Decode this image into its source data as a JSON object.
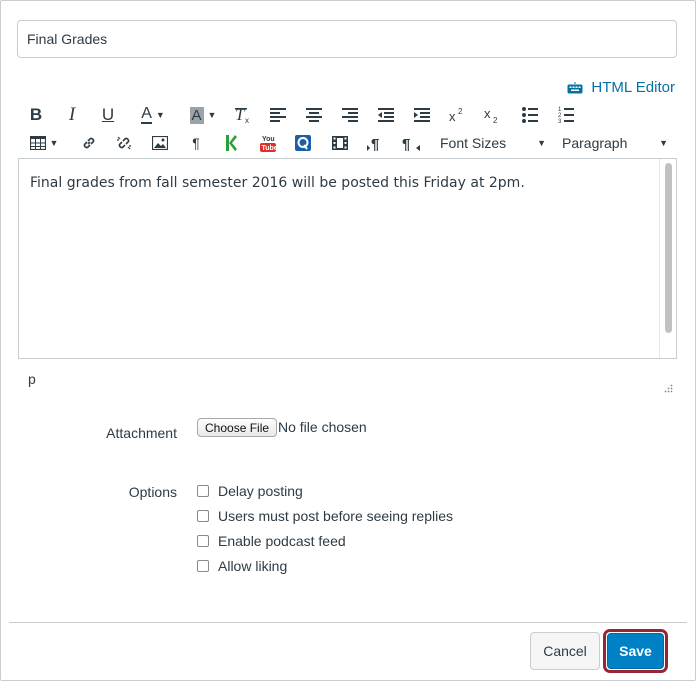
{
  "title_field": {
    "value": "Final Grades"
  },
  "html_editor_link": {
    "label": "HTML Editor"
  },
  "toolbar": {
    "bold": "B",
    "italic": "I",
    "underline": "U",
    "text_color": "A",
    "bg_color": "A",
    "font_sizes": "Font Sizes",
    "paragraph": "Paragraph",
    "icons_row1": [
      "bold-icon",
      "italic-icon",
      "underline-icon",
      "text-color-icon",
      "background-color-icon",
      "clear-formatting-icon",
      "align-left-icon",
      "align-center-icon",
      "align-right-icon",
      "outdent-icon",
      "indent-icon",
      "superscript-icon",
      "subscript-icon",
      "bullet-list-icon",
      "numbered-list-icon"
    ],
    "icons_row2": [
      "table-icon",
      "link-icon",
      "unlink-icon",
      "image-icon",
      "pilcrow-icon",
      "kaltura-icon",
      "youtube-icon",
      "quizlet-icon",
      "media-icon",
      "ltr-icon",
      "rtl-icon"
    ],
    "youtube_text": "You Tube"
  },
  "editor": {
    "content": "Final grades from fall semester 2016 will be posted this Friday at 2pm.",
    "path": "p"
  },
  "attachment": {
    "label": "Attachment",
    "button": "Choose File",
    "status": "No file chosen"
  },
  "options": {
    "label": "Options",
    "items": [
      "Delay posting",
      "Users must post before seeing replies",
      "Enable podcast feed",
      "Allow liking"
    ]
  },
  "footer": {
    "cancel": "Cancel",
    "save": "Save"
  },
  "colors": {
    "link": "#0770a3",
    "save_button": "#0081c6",
    "save_highlight": "#962634"
  }
}
